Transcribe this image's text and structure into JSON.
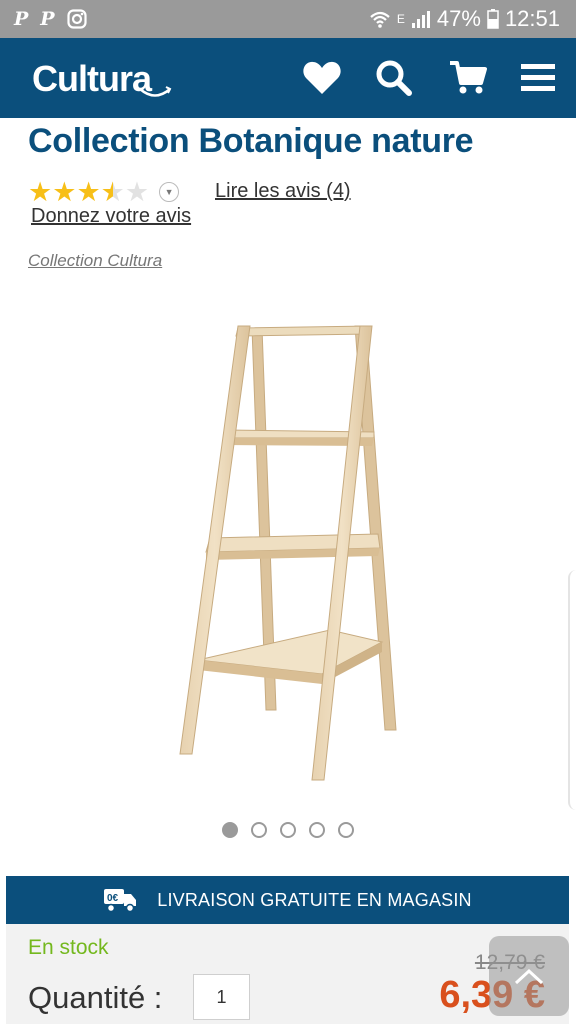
{
  "status_bar": {
    "notif_icons": [
      "pinterest-icon",
      "pinterest-icon",
      "instagram-icon"
    ],
    "notif_glyphs": [
      "P",
      "P"
    ],
    "network_label": "E",
    "battery": "47%",
    "time": "12:51"
  },
  "header": {
    "logo": "Cultura",
    "icons": [
      "heart-icon",
      "search-icon",
      "cart-icon",
      "menu-icon"
    ]
  },
  "product": {
    "title": "Collection Botanique nature",
    "rating": 3.5,
    "reviews_link": "Lire les avis (4)",
    "give_review": "Donnez votre avis",
    "collection_link": "Collection Cultura"
  },
  "carousel": {
    "count": 5,
    "active_index": 0
  },
  "delivery": {
    "label": "LIVRAISON GRATUITE EN MAGASIN",
    "icon": "truck-icon"
  },
  "buy": {
    "stock": "En stock",
    "quantity_label": "Quantité :",
    "quantity_value": "1",
    "old_price": "12,79 €",
    "new_price": "6,39 €"
  },
  "colors": {
    "brand_blue": "#0b4f7c",
    "price_orange": "#d9501d",
    "stock_green": "#74b81e",
    "star_yellow": "#f7bf18"
  }
}
